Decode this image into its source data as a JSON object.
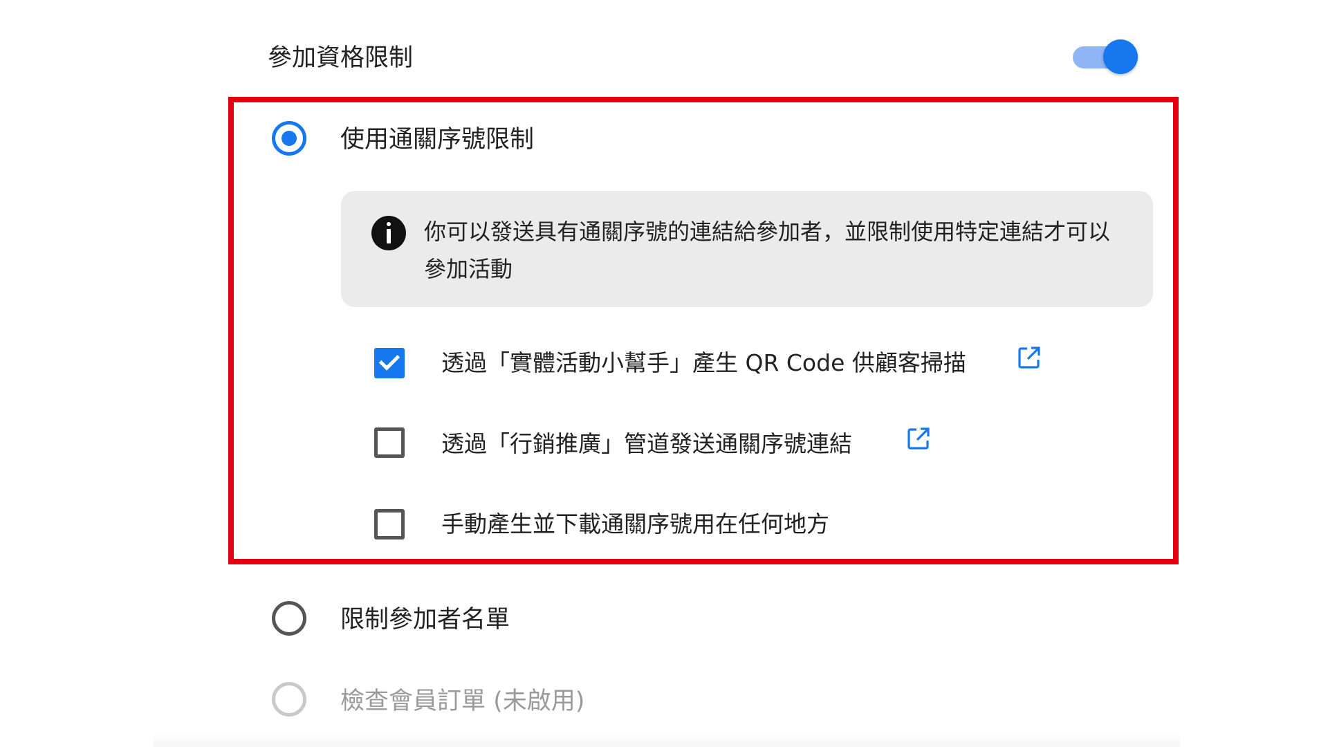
{
  "header": {
    "title": "參加資格限制",
    "toggle_on": true
  },
  "options": {
    "pass_code": {
      "label": "使用通關序號限制",
      "selected": true
    },
    "attendee_list": {
      "label": "限制參加者名單",
      "selected": false
    },
    "member_orders": {
      "label": "檢查會員訂單 (未啟用)",
      "disabled": true
    }
  },
  "info": {
    "icon": "info-icon",
    "text": "你可以發送具有通關序號的連結給參加者，並限制使用特定連結才可以參加活動"
  },
  "checkboxes": [
    {
      "label": "透過「實體活動小幫手」產生 QR Code 供顧客掃描",
      "checked": true,
      "has_link": true
    },
    {
      "label": "透過「行銷推廣」管道發送通關序號連結",
      "checked": false,
      "has_link": true
    },
    {
      "label": "手動產生並下載通關序號用在任何地方",
      "checked": false,
      "has_link": false
    }
  ],
  "colors": {
    "accent": "#1677ee",
    "toggle_track": "#8fb5f5",
    "highlight_border": "#e3000f",
    "info_background": "#ebebeb",
    "disabled_text": "#9a9a9a"
  }
}
